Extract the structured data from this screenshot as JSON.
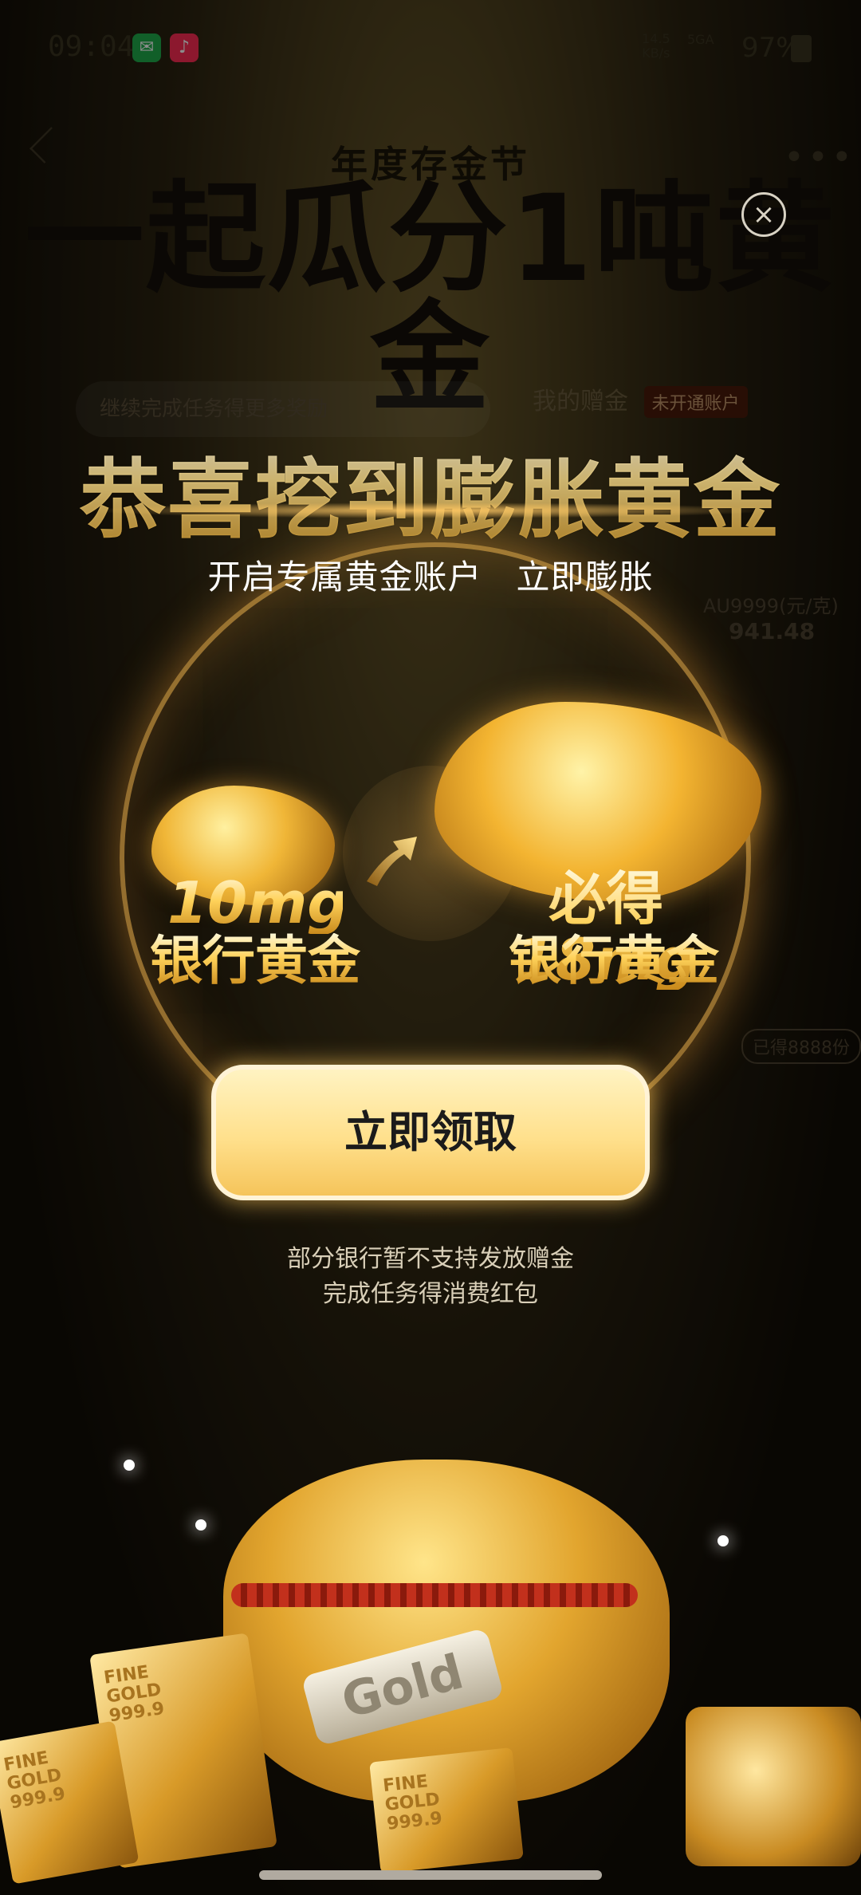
{
  "status_bar": {
    "time": "09:04",
    "network_speed": "14.5\nKB/s",
    "signal": "5GA",
    "battery": "97%"
  },
  "background_page": {
    "event_title": "年度存金节",
    "event_headline": "一起瓜分1吨黄金",
    "task_hint": "继续完成任务得更多奖励",
    "my_gold_label": "我的赠金",
    "my_gold_tag": "未开通账户",
    "price_label": "AU9999(元/克)",
    "price_value": "941.48",
    "badge": "已得8888份"
  },
  "modal": {
    "headline": "恭喜挖到膨胀黄金",
    "subheadline": "开启专属黄金账户   立即膨胀",
    "from_amount": "10mg",
    "from_label": "银行黄金",
    "to_prefix": "必得",
    "to_amount": "18mg",
    "to_label": "银行黄金",
    "claim_button": "立即领取",
    "note_line1": "部分银行暂不支持发放赠金",
    "note_line2": "完成任务得消费红包",
    "close_symbol": "×"
  },
  "decoration": {
    "tag_text": "Gold",
    "bar1_text": "FINE\nGOLD\n999.9",
    "bar2_text": "FINE\nGOLD\n999.9",
    "bar3_text": "FINE\nGOLD\n999.9"
  },
  "colors": {
    "accent_gold": "#ffd25a",
    "button_fill": "#ffe08c",
    "wechat_green": "#1fae4c",
    "music_red": "#ff2d55"
  },
  "icons": {
    "back": "chevron-left-icon",
    "more": "more-dots-icon",
    "close": "close-circle-icon",
    "arrow": "arrow-up-right-icon"
  }
}
